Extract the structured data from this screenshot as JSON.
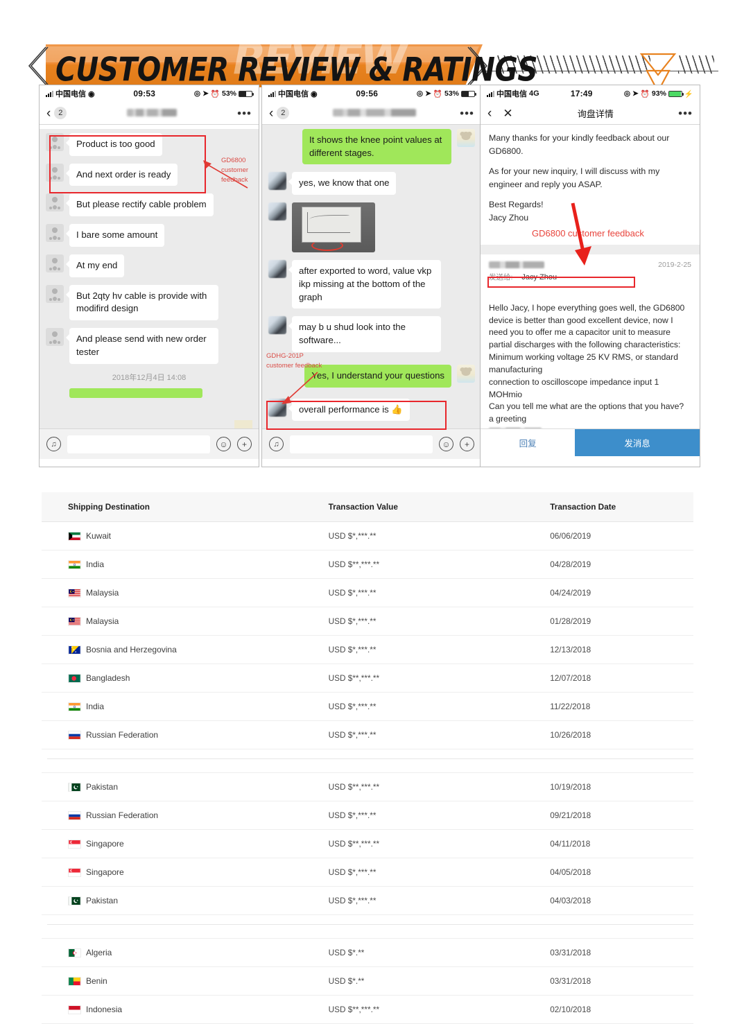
{
  "banner": {
    "title": "CUSTOMER REVIEW & RATINGS",
    "ghost_text": "REVIEW",
    "accent_color": "#e8821f",
    "triangle_color": "#e8821f"
  },
  "phones": [
    {
      "id": "phone-1",
      "status": {
        "carrier": "中国电信",
        "network": "wifi-icon",
        "time": "09:53",
        "battery": "53%"
      },
      "nav": {
        "back": "chevron-left-icon",
        "unread_count": "2",
        "title": "",
        "title_state": "blurred",
        "more": "•••"
      },
      "messages": [
        {
          "side": "left",
          "avatar": "person",
          "text": "Product is too good"
        },
        {
          "side": "left",
          "avatar": "person",
          "text": "And next order is ready"
        },
        {
          "side": "left",
          "avatar": "person",
          "text": "But please rectify cable problem"
        },
        {
          "side": "left",
          "avatar": "person",
          "text": "I bare some amount"
        },
        {
          "side": "left",
          "avatar": "person",
          "text": "At my end"
        },
        {
          "side": "left",
          "avatar": "person",
          "text": "But 2qty hv cable is provide with modifird design"
        },
        {
          "side": "left",
          "avatar": "person",
          "text": "And please send with new order tester"
        }
      ],
      "timestamp": "2018年12月4日 14:08",
      "annotation": {
        "line1": "GD6800",
        "line2": "customer",
        "line3": "feedback"
      },
      "toolbar": {
        "voice": "voice-icon",
        "input_value": "",
        "emoji": "emoji-icon",
        "plus": "plus-icon"
      }
    },
    {
      "id": "phone-2",
      "status": {
        "carrier": "中国电信",
        "network": "wifi-icon",
        "time": "09:56",
        "battery": "53%"
      },
      "nav": {
        "back": "chevron-left-icon",
        "unread_count": "2",
        "title": "",
        "title_state": "blurred",
        "more": "•••"
      },
      "messages": [
        {
          "side": "right",
          "avatar": "rabbit",
          "text": "It shows the knee point values at different stages."
        },
        {
          "side": "left",
          "avatar": "photo",
          "text": "yes, we know that one"
        },
        {
          "side": "left",
          "avatar": "photo",
          "text": "",
          "type": "image"
        },
        {
          "side": "left",
          "avatar": "photo",
          "text": "after exported to word, value vkp ikp missing at the bottom of the graph"
        },
        {
          "side": "left",
          "avatar": "photo",
          "text": "may b u shud look into the software..."
        },
        {
          "side": "right",
          "avatar": "rabbit",
          "text": "Yes, I understand your questions"
        },
        {
          "side": "left",
          "avatar": "photo",
          "text": "overall performance is 👍"
        }
      ],
      "annotation": {
        "line1": "GDHG-201P",
        "line2": "customer feedback"
      },
      "toolbar": {
        "voice": "voice-icon",
        "input_value": "",
        "emoji": "emoji-icon",
        "plus": "plus-icon"
      }
    },
    {
      "id": "phone-3",
      "status": {
        "carrier": "中国电信",
        "network": "4G",
        "time": "17:49",
        "battery": "93%"
      },
      "nav": {
        "back": "chevron-left-icon",
        "close": "close-icon",
        "title": "询盘详情",
        "more": "•••"
      },
      "mail": {
        "paragraphs": [
          "Many thanks for your kindly feedback about our GD6800.",
          "As for your new inquiry, I will discuss with my engineer and reply you ASAP.",
          "Best Regards!\nJacy Zhou"
        ],
        "annotation": "GD6800 customer feedback",
        "quoted": {
          "sender": "",
          "date": "2019-2-25",
          "to_label": "发送给:",
          "to_name": "Jacy Zhou",
          "body_before": "Hello Jacy, I hope everything goes well, the ",
          "highlight": "GD6800 device is better than good",
          "body_after": " excellent device, now I need you to offer me a capacitor unit to measure partial discharges with the following characteristics:\nMinimum working voltage 25 KV RMS, or standard manufacturing\nconnection to oscilloscope impedance input 1 MOHmio\nCan you tell me what are the options that you have?\na greeting"
        }
      },
      "actions": {
        "reply": "回复",
        "send": "发消息"
      }
    }
  ],
  "table": {
    "columns": [
      "Shipping Destination",
      "Transaction Value",
      "Transaction Date"
    ],
    "rows": [
      {
        "country": "Kuwait",
        "flag": "kw",
        "value": "USD $*,***.**",
        "date": "06/06/2019"
      },
      {
        "country": "India",
        "flag": "in",
        "value": "USD $**,***.**",
        "date": "04/28/2019"
      },
      {
        "country": "Malaysia",
        "flag": "my",
        "value": "USD $*,***.**",
        "date": "04/24/2019"
      },
      {
        "country": "Malaysia",
        "flag": "my",
        "value": "USD $*,***.**",
        "date": "01/28/2019"
      },
      {
        "country": "Bosnia and Herzegovina",
        "flag": "ba",
        "value": "USD $*,***.**",
        "date": "12/13/2018"
      },
      {
        "country": "Bangladesh",
        "flag": "bd",
        "value": "USD $**,***.**",
        "date": "12/07/2018"
      },
      {
        "country": "India",
        "flag": "in",
        "value": "USD $*,***.**",
        "date": "11/22/2018"
      },
      {
        "country": "Russian Federation",
        "flag": "ru",
        "value": "USD $*,***.**",
        "date": "10/26/2018"
      },
      {
        "country": "Pakistan",
        "flag": "pk",
        "value": "USD $**,***.**",
        "date": "10/19/2018",
        "section_break": true
      },
      {
        "country": "Russian Federation",
        "flag": "ru",
        "value": "USD $*,***.**",
        "date": "09/21/2018"
      },
      {
        "country": "Singapore",
        "flag": "sg",
        "value": "USD $**,***.**",
        "date": "04/11/2018"
      },
      {
        "country": "Singapore",
        "flag": "sg",
        "value": "USD $*,***.**",
        "date": "04/05/2018"
      },
      {
        "country": "Pakistan",
        "flag": "pk",
        "value": "USD $*,***.**",
        "date": "04/03/2018"
      },
      {
        "country": "Algeria",
        "flag": "dz",
        "value": "USD $*.**",
        "date": "03/31/2018",
        "section_break": true
      },
      {
        "country": "Benin",
        "flag": "bj",
        "value": "USD $*.**",
        "date": "03/31/2018"
      },
      {
        "country": "Indonesia",
        "flag": "id",
        "value": "USD $**,***.**",
        "date": "02/10/2018"
      }
    ]
  }
}
